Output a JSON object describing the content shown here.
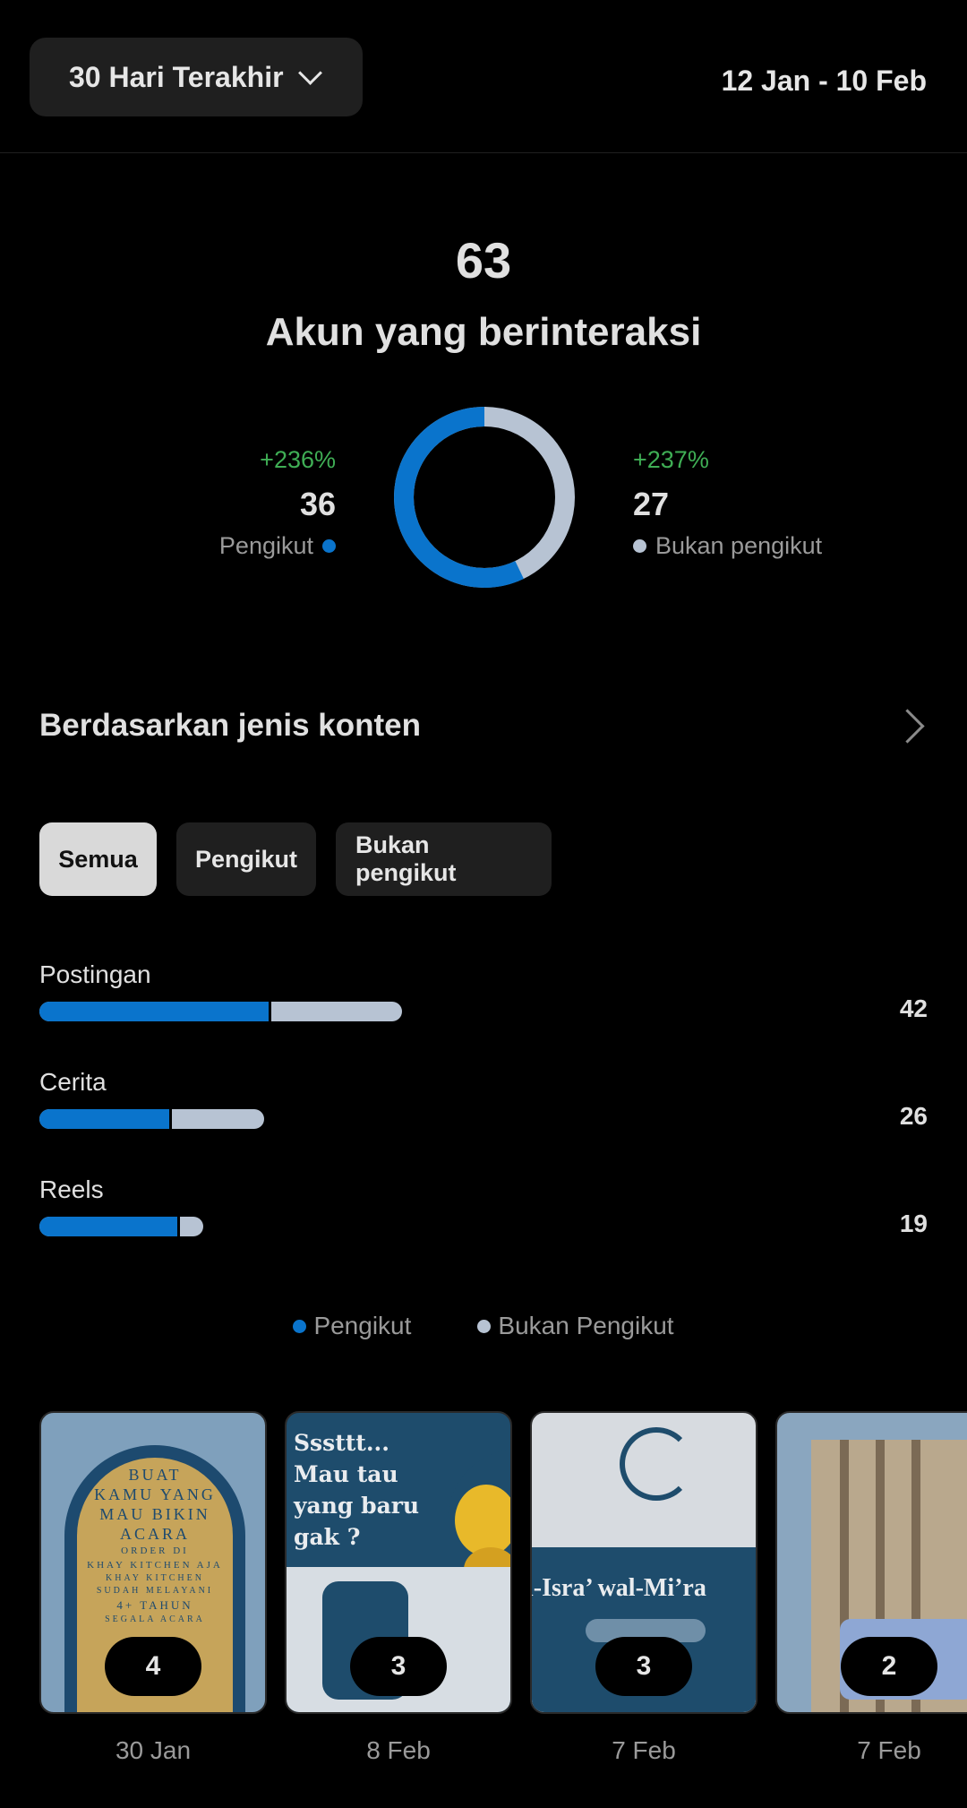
{
  "header": {
    "range_label": "30 Hari Terakhir",
    "date_range": "12 Jan - 10 Feb"
  },
  "summary": {
    "total": "63",
    "total_label": "Akun yang berinteraksi"
  },
  "followers": {
    "pct": "+236%",
    "count": "36",
    "label": "Pengikut",
    "color": "#0a74cc",
    "share": 0.5714
  },
  "non_followers": {
    "pct": "+237%",
    "count": "27",
    "label": "Bukan pengikut",
    "color": "#b7c3d3",
    "share": 0.4286
  },
  "content_section": {
    "title": "Berdasarkan jenis konten",
    "filters": [
      "Semua",
      "Pengikut",
      "Bukan pengikut"
    ],
    "active_filter": "Semua"
  },
  "chart_data": {
    "type": "bar",
    "categories": [
      "Postingan",
      "Cerita",
      "Reels"
    ],
    "totals": [
      42,
      26,
      19
    ],
    "series": [
      {
        "name": "Pengikut",
        "values": [
          26.5,
          15,
          16
        ]
      },
      {
        "name": "Bukan Pengikut",
        "values": [
          15.5,
          11,
          3
        ]
      }
    ]
  },
  "legend": {
    "followers": "Pengikut",
    "non_followers": "Bukan Pengikut"
  },
  "posts": [
    {
      "count": "4",
      "date": "30 Jan",
      "text": [
        "BUAT",
        "KAMU YANG",
        "MAU BIKIN",
        "ACARA",
        "ORDER DI",
        "KHAY KITCHEN AJA",
        "KHAY KITCHEN",
        "SUDAH MELAYANI",
        "4+ TAHUN",
        "SEGALA ACARA"
      ]
    },
    {
      "count": "3",
      "date": "8 Feb",
      "text": [
        "Sssttt...",
        "Mau tau",
        "yang baru",
        "gak ?"
      ]
    },
    {
      "count": "3",
      "date": "7 Feb",
      "text": [
        "l-Isra’ wal-Mi’ra"
      ]
    },
    {
      "count": "2",
      "date": "7 Feb"
    }
  ]
}
